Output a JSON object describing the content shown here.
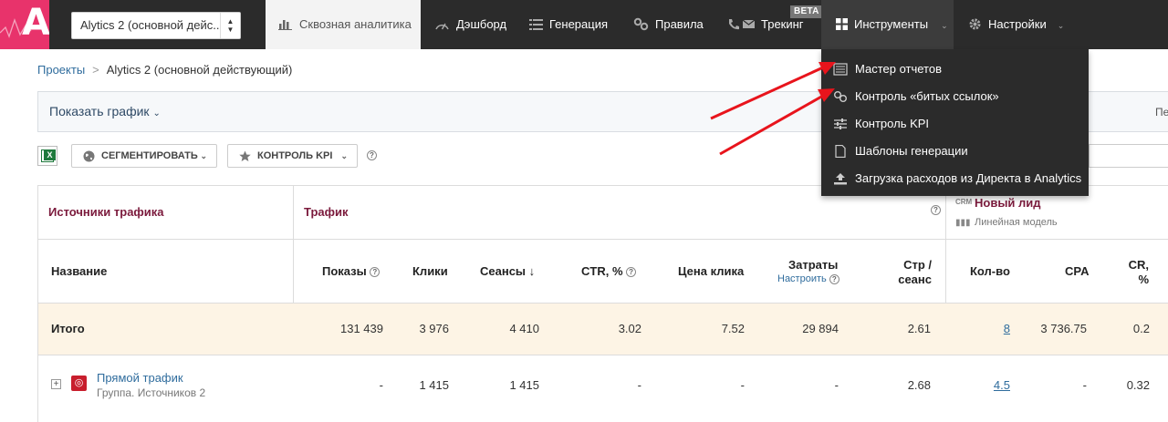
{
  "app": {
    "logo_letter": "A",
    "project_selected": "Alytics 2 (основной дейс..."
  },
  "nav": {
    "tabs": [
      {
        "label": "Сквозная аналитика",
        "icon": "bar-chart-icon"
      },
      {
        "label": "Дэшборд",
        "icon": "gauge-icon"
      },
      {
        "label": "Генерация",
        "icon": "list-icon"
      },
      {
        "label": "Правила",
        "icon": "gears-icon"
      },
      {
        "label": "Трекинг",
        "icon": "phone-mail-icon",
        "badge": "BETA"
      },
      {
        "label": "Инструменты",
        "icon": "grid-icon"
      },
      {
        "label": "Настройки",
        "icon": "gear-icon"
      }
    ]
  },
  "tools_menu": {
    "items": [
      {
        "label": "Мастер отчетов",
        "icon": "report-icon"
      },
      {
        "label": "Контроль «битых ссылок»",
        "icon": "chain-link-icon"
      },
      {
        "label": "Контроль KPI",
        "icon": "sliders-icon"
      },
      {
        "label": "Шаблоны генерации",
        "icon": "document-icon"
      },
      {
        "label": "Загрузка расходов из Директа в Analytics",
        "icon": "upload-icon"
      }
    ]
  },
  "breadcrumb": {
    "root": "Проекты",
    "separator": ">",
    "current": "Alytics 2 (основной действующий)"
  },
  "graph_panel": {
    "toggle_label": "Показать график",
    "right_text": "Пе"
  },
  "toolbar": {
    "segment_label": "СЕГМЕНТИРОВАТЬ",
    "kpi_label": "КОНТРОЛЬ KPI",
    "help": "?"
  },
  "table": {
    "group_headers": {
      "sources": "Источники трафика",
      "traffic": "Трафик",
      "lead": {
        "crm_tag": "CRM",
        "title": "Новый лид",
        "model": "Линейная модель"
      }
    },
    "columns": {
      "name": "Название",
      "impressions": "Показы",
      "clicks": "Клики",
      "sessions": "Сеансы",
      "ctr": "CTR, %",
      "cpc": "Цена клика",
      "costs": "Затраты",
      "costs_link": "Настроить",
      "pages_l1": "Стр /",
      "pages_l2": "сеанс",
      "count": "Кол-во",
      "cpa": "CPA",
      "cr_l1": "CR,",
      "cr_l2": "%"
    },
    "total": {
      "name": "Итого",
      "impressions": "131 439",
      "clicks": "3 976",
      "sessions": "4 410",
      "ctr": "3.02",
      "cpc": "7.52",
      "costs": "29 894",
      "pages": "2.61",
      "count": "8",
      "cpa": "3 736.75",
      "cr": "0.2"
    },
    "rows": [
      {
        "name": "Прямой трафик",
        "sub": "Группа. Источников 2",
        "impressions": "-",
        "clicks": "1 415",
        "sessions": "1 415",
        "ctr": "-",
        "cpc": "-",
        "costs": "-",
        "pages": "2.68",
        "count": "4.5",
        "cpa": "-",
        "cr": "0.32"
      }
    ]
  },
  "colors": {
    "topbar": "#2b2b2b",
    "logo": "#e8336b",
    "group_header": "#7b1a3c",
    "link": "#2f6c9d",
    "total_row": "#fdf4e5",
    "arrow": "#e8141c"
  }
}
